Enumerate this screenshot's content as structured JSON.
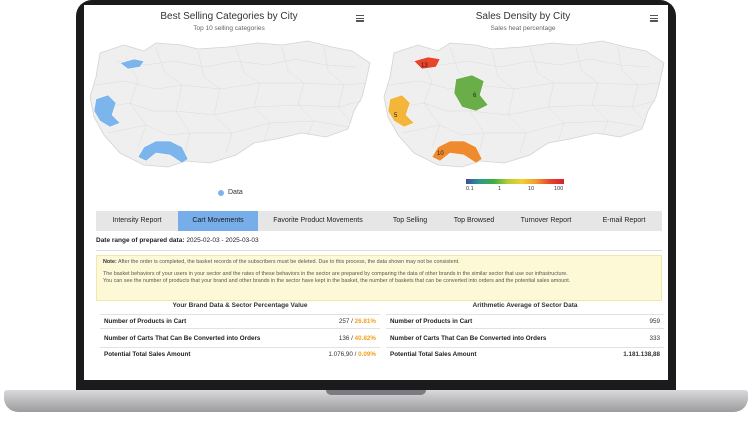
{
  "charts": {
    "left": {
      "title": "Best Selling Categories by City",
      "subtitle": "Top 10 selling categories",
      "legend_label": "Data",
      "legend_color": "#7cb5ec"
    },
    "right": {
      "title": "Sales Density by City",
      "subtitle": "Sales heat percentage",
      "region_labels": [
        "13",
        "6",
        "5",
        "10"
      ],
      "scale_labels": [
        "0.1",
        "1",
        "10",
        "100"
      ]
    }
  },
  "tabs": [
    {
      "label": "Intensity Report",
      "active": false
    },
    {
      "label": "Cart Movements",
      "active": true
    },
    {
      "label": "Favorite Product Movements",
      "active": false
    },
    {
      "label": "Top Selling",
      "active": false
    },
    {
      "label": "Top Browsed",
      "active": false
    },
    {
      "label": "Turnover Report",
      "active": false
    },
    {
      "label": "E-mail Report",
      "active": false
    }
  ],
  "date_range": {
    "label": "Date range of prepared data:",
    "value": "2025-02-03 - 2025-03-03"
  },
  "note": {
    "label": "Note:",
    "line1": "After the order is completed, the basket records of the subscribers must be deleted. Due to this process, the data shown may not be consistent.",
    "line2": "The basket behaviors of your users in your sector and the rates of these behaviors in the sector are prepared by comparing the data of other brands in the similar sector that use our infrastructure.",
    "line3": "You can see the number of products that your brand and other brands in the sector have kept in the basket, the number of baskets that can be converted into orders and the potential sales amount."
  },
  "brand_table": {
    "title": "Your Brand Data & Sector Percentage Value",
    "rows": [
      {
        "label": "Number of Products in Cart",
        "value": "257",
        "pct": "26.81%"
      },
      {
        "label": "Number of Carts That Can Be Converted into Orders",
        "value": "136",
        "pct": "40.82%"
      },
      {
        "label": "Potential Total Sales Amount",
        "value": "1.076,90",
        "pct": "0.09%"
      }
    ]
  },
  "sector_table": {
    "title": "Arithmetic Average of Sector Data",
    "rows": [
      {
        "label": "Number of Products in Cart",
        "value": "959"
      },
      {
        "label": "Number of Carts That Can Be Converted into Orders",
        "value": "333"
      },
      {
        "label": "Potential Total Sales Amount",
        "value": "1.181.138,88"
      }
    ]
  },
  "colors": {
    "active_tab": "#77aeea",
    "percentage": "#f0a020",
    "sector_total": "#2e8b2e",
    "map_base": "#efefef",
    "map_highlight": "#7cb5ec"
  }
}
